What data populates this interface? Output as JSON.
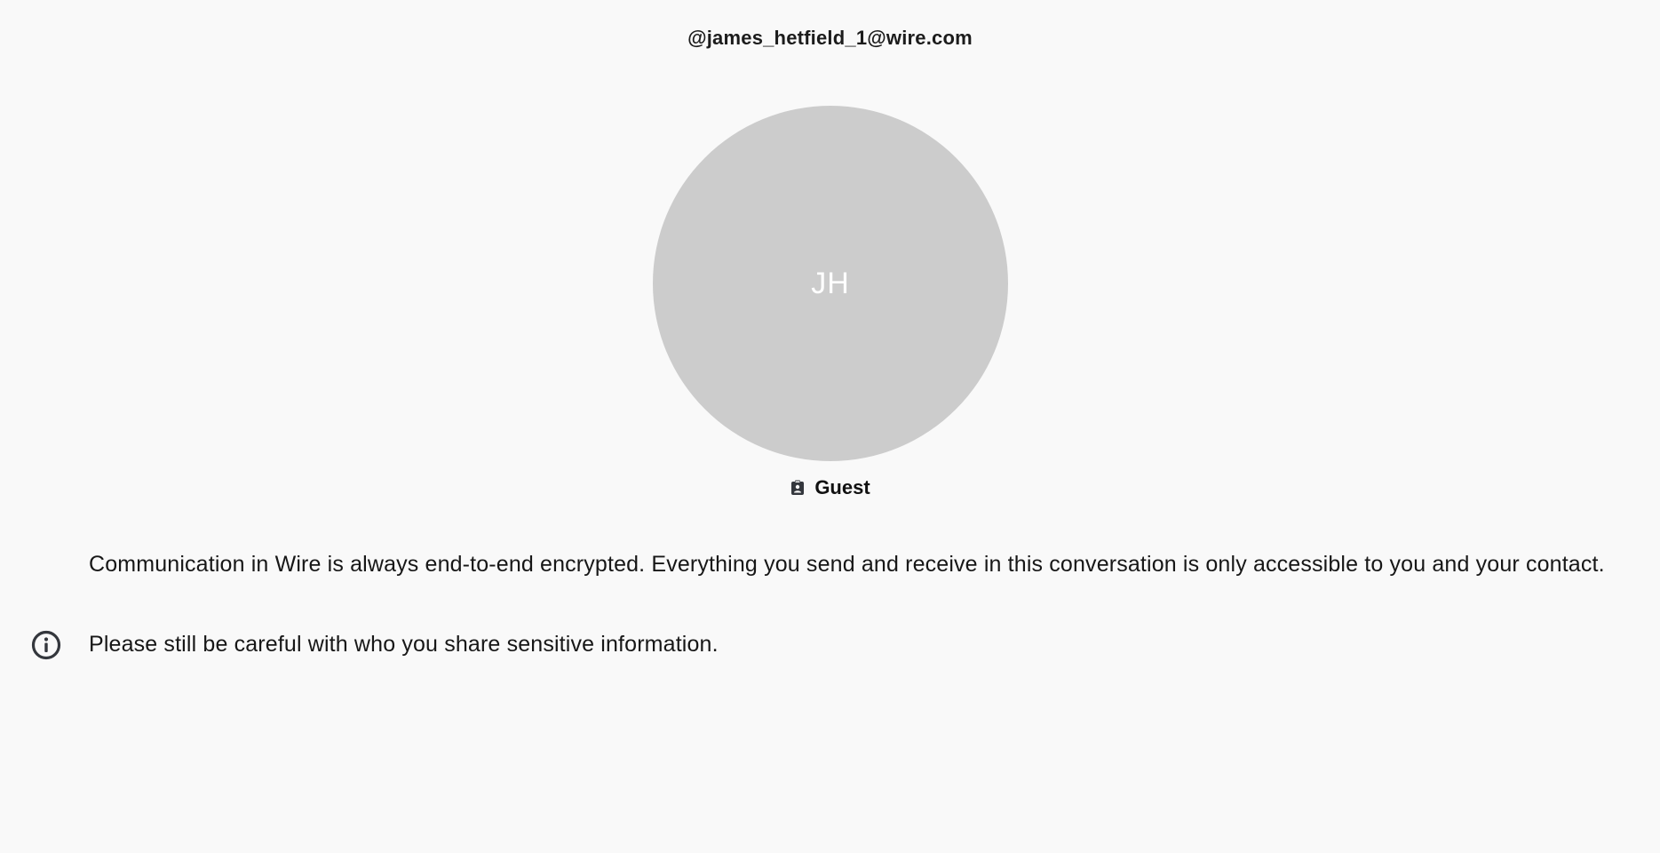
{
  "header": {
    "handle": "@james_hetfield_1@wire.com"
  },
  "profile": {
    "initials": "JH",
    "avatar_color": "#cccccc",
    "role_icon": "guest-badge-icon",
    "role_label": "Guest"
  },
  "messages": {
    "encryption_notice": "Communication in Wire is always end-to-end encrypted. Everything you send and receive in this conversation is only accessible to you and your contact.",
    "info_icon": "info-icon",
    "careful_notice": "Please still be careful with who you share sensitive information."
  },
  "colors": {
    "background": "#f9f9f9",
    "icon": "#34373d",
    "text": "#171717"
  }
}
